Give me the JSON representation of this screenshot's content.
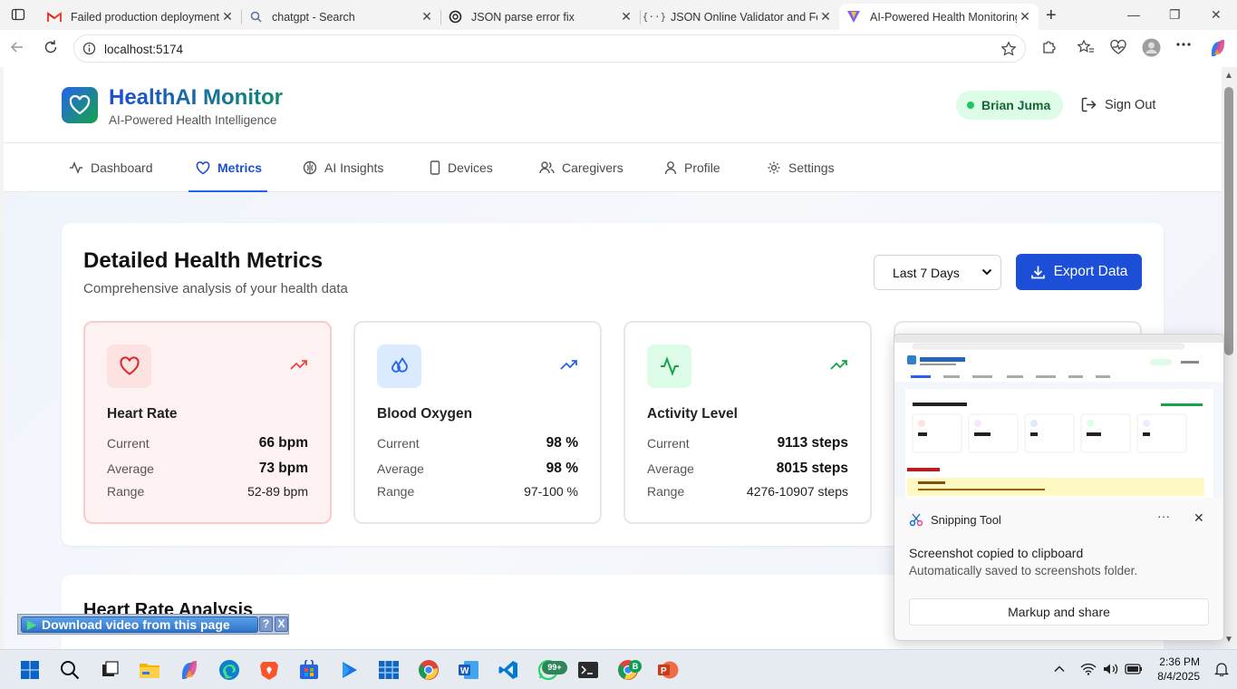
{
  "browser": {
    "tabs": [
      {
        "title": "Failed production deployment",
        "icon": "gmail-icon"
      },
      {
        "title": "chatgpt - Search",
        "icon": "search-icon"
      },
      {
        "title": "JSON parse error fix",
        "icon": "chatgpt-icon"
      },
      {
        "title": "JSON Online Validator and Fo",
        "icon": "code-brackets-icon"
      },
      {
        "title": "AI-Powered Health Monitoring",
        "icon": "vite-icon"
      }
    ],
    "url": "localhost:5174"
  },
  "header": {
    "brand": "HealthAI Monitor",
    "tagline": "AI-Powered Health Intelligence",
    "user": "Brian Juma",
    "signout": "Sign Out"
  },
  "nav": [
    "Dashboard",
    "Metrics",
    "AI Insights",
    "Devices",
    "Caregivers",
    "Profile",
    "Settings"
  ],
  "main": {
    "title": "Detailed Health Metrics",
    "subtitle": "Comprehensive analysis of your health data",
    "range": "Last 7 Days",
    "export": "Export Data",
    "next_section": "Heart Rate Analysis"
  },
  "metrics": [
    {
      "name": "Heart Rate",
      "current": "66 bpm",
      "average": "73 bpm",
      "range": "52-89 bpm"
    },
    {
      "name": "Blood Oxygen",
      "current": "98 %",
      "average": "98 %",
      "range": "97-100 %"
    },
    {
      "name": "Activity Level",
      "current": "9113 steps",
      "average": "8015 steps",
      "range": "4276-10907 steps"
    }
  ],
  "labels": {
    "current": "Current",
    "average": "Average",
    "range": "Range"
  },
  "downloadbar": {
    "label": "Download video from this page",
    "help": "?",
    "close": "X"
  },
  "snipping": {
    "app": "Snipping Tool",
    "title": "Screenshot copied to clipboard",
    "body": "Automatically saved to screenshots folder.",
    "action": "Markup and share"
  },
  "taskbar": {
    "time": "2:36 PM",
    "date": "8/4/2025",
    "whatsapp_badge": "99+",
    "chrome_badge": "B"
  },
  "colors": {
    "accent": "#1d4ed8",
    "heart": "#dc2626",
    "oxygen": "#2563eb",
    "activity": "#16a34a"
  }
}
